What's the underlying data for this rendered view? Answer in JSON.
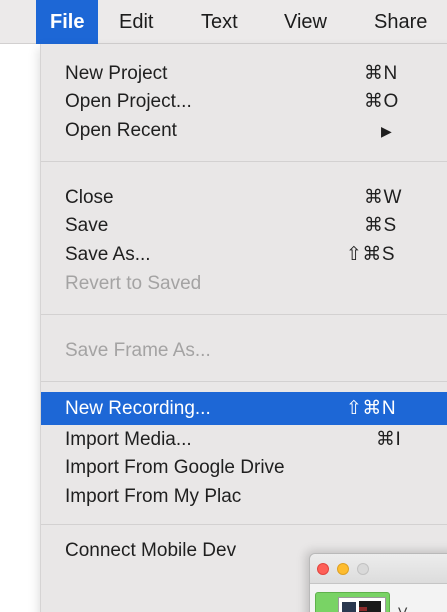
{
  "menubar": {
    "items": [
      {
        "label": "File"
      },
      {
        "label": "Edit"
      },
      {
        "label": "Text"
      },
      {
        "label": "View"
      },
      {
        "label": "Share"
      }
    ]
  },
  "file_menu": {
    "new_project": {
      "label": "New Project",
      "shortcut": "⌘N"
    },
    "open_project": {
      "label": "Open Project...",
      "shortcut": "⌘O"
    },
    "open_recent": {
      "label": "Open Recent",
      "submenu_arrow": "▶"
    },
    "close": {
      "label": "Close",
      "shortcut": "⌘W"
    },
    "save": {
      "label": "Save",
      "shortcut": "⌘S"
    },
    "save_as": {
      "label": "Save As...",
      "shortcut": "⇧⌘S"
    },
    "revert_to_saved": {
      "label": "Revert to Saved"
    },
    "save_frame_as": {
      "label": "Save Frame As..."
    },
    "new_recording": {
      "label": "New Recording...",
      "shortcut": "⇧⌘N"
    },
    "import_media": {
      "label": "Import Media...",
      "shortcut": "⌘I"
    },
    "import_google_drive": {
      "label": "Import From Google Drive"
    },
    "import_my_place": {
      "label": "Import From My Plac"
    },
    "connect_mobile": {
      "label": "Connect Mobile Dev"
    }
  },
  "colors": {
    "highlight": "#1d67d6",
    "menu_background": "#e9e7e7",
    "disabled_text": "#a4a3a3"
  },
  "overlay_window": {
    "traffic_lights": [
      "close",
      "minimize",
      "zoom"
    ],
    "side_text": "V"
  }
}
